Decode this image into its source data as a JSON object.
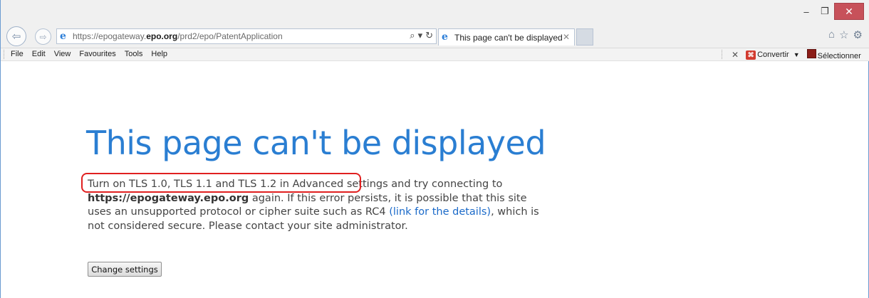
{
  "window": {
    "controls": {
      "minimize": "–",
      "restore": "❐",
      "close": "✕"
    }
  },
  "nav": {
    "back_glyph": "⇦",
    "forward_glyph": "⇨",
    "url_prefix": "https://epogateway.",
    "url_domain": "epo.org",
    "url_path": "/prd2/epo/PatentApplication",
    "search_glyph": "⌕",
    "dropdown_glyph": "▾",
    "refresh_glyph": "↻",
    "ie_glyph": "e",
    "right_icons": [
      "⌂",
      "☆",
      "⚙"
    ]
  },
  "tab": {
    "title": "This page can't be displayed",
    "close": "✕"
  },
  "menubar": {
    "items": [
      "File",
      "Edit",
      "View",
      "Favourites",
      "Tools",
      "Help"
    ],
    "close_glyph": "✕",
    "convert_label": "Convertir",
    "convert_caret": "▼",
    "select_label": "Sélectionner",
    "pdf_glyph": "⌘"
  },
  "content": {
    "title": "This page can't be displayed",
    "line1": "Turn on TLS 1.0, TLS 1.1 and TLS 1.2 in Advanced settings",
    "line1_rest": " and try connecting to",
    "bold_url": "https://epogateway.epo.org",
    "middle": " again. If this error persists, it is possible that this site uses an unsupported protocol or cipher suite such as RC4 ",
    "link": "(link for the details)",
    "end": ", which is not considered secure. Please contact your site administrator.",
    "button": "Change settings"
  },
  "colors": {
    "title_blue": "#2a7ed2",
    "link_blue": "#1b6ac9",
    "highlight_red": "#e02020",
    "close_red": "#c7515a"
  }
}
